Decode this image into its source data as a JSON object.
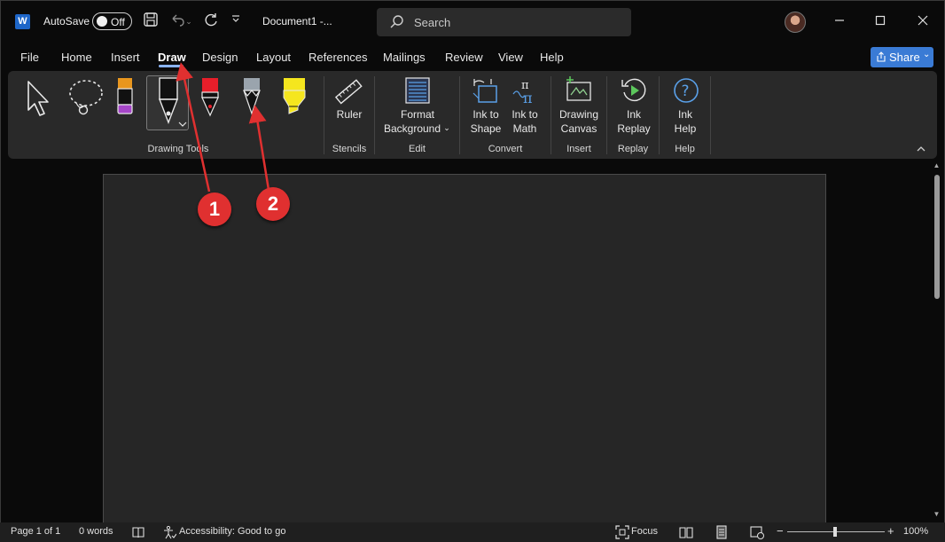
{
  "titlebar": {
    "app_logo": "W",
    "autosave_label": "AutoSave",
    "autosave_state": "Off",
    "document_title": "Document1  -...",
    "search_placeholder": "Search",
    "icons": [
      "save-icon",
      "undo-icon",
      "redo-icon",
      "customize-qat-icon"
    ]
  },
  "tabs": [
    {
      "label": "File"
    },
    {
      "label": "Home"
    },
    {
      "label": "Insert"
    },
    {
      "label": "Draw",
      "active": true
    },
    {
      "label": "Design"
    },
    {
      "label": "Layout"
    },
    {
      "label": "References"
    },
    {
      "label": "Mailings"
    },
    {
      "label": "Review"
    },
    {
      "label": "View"
    },
    {
      "label": "Help"
    }
  ],
  "share_label": "Share",
  "ribbon": {
    "groups": {
      "drawing_tools": "Drawing Tools",
      "stencils": "Stencils",
      "edit": "Edit",
      "convert": "Convert",
      "insert": "Insert",
      "replay": "Replay",
      "help": "Help"
    },
    "buttons": {
      "ruler": "Ruler",
      "format_background_1": "Format",
      "format_background_2": "Background",
      "ink_to_shape_1": "Ink to",
      "ink_to_shape_2": "Shape",
      "ink_to_math_1": "Ink to",
      "ink_to_math_2": "Math",
      "drawing_canvas_1": "Drawing",
      "drawing_canvas_2": "Canvas",
      "ink_replay_1": "Ink",
      "ink_replay_2": "Replay",
      "ink_help_1": "Ink",
      "ink_help_2": "Help"
    },
    "colors": {
      "pen_orange": "#e8961e",
      "pen_red": "#e81e2a",
      "pencil_gray": "#9aa4ad",
      "highlighter_yellow": "#f5e61e",
      "accent_blue": "#5aa0e8"
    }
  },
  "annotations": {
    "marker_1": "1",
    "marker_2": "2",
    "color": "#e03030"
  },
  "status": {
    "page": "Page 1 of 1",
    "words": "0 words",
    "accessibility": "Accessibility: Good to go",
    "focus": "Focus",
    "zoom": "100%"
  }
}
